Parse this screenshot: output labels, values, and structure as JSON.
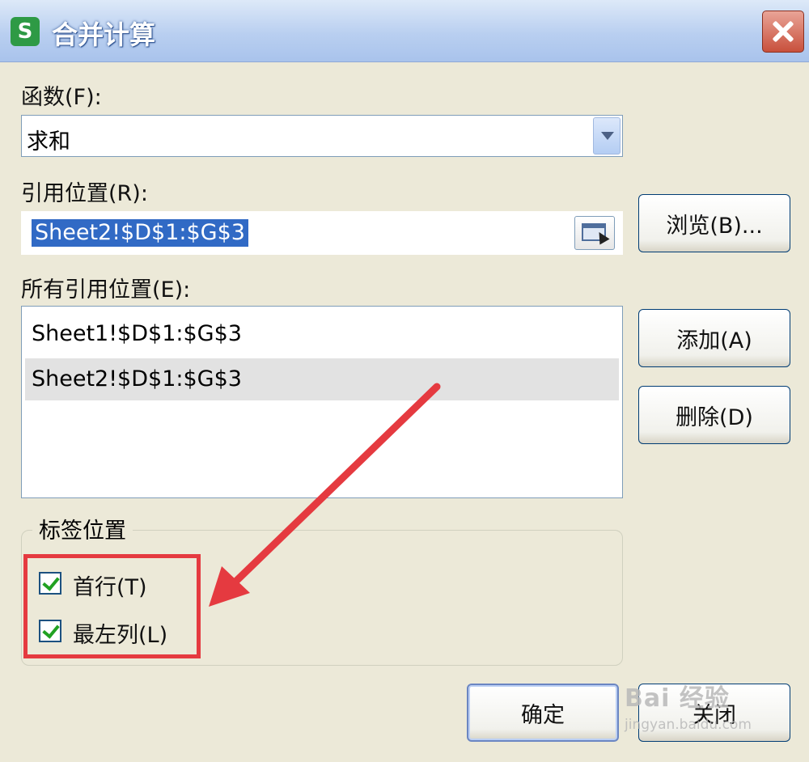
{
  "window": {
    "app_icon_letter": "S",
    "title": "合并计算"
  },
  "function_field": {
    "label": "函数(F):",
    "value": "求和"
  },
  "reference_field": {
    "label": "引用位置(R):",
    "value": "Sheet2!$D$1:$G$3"
  },
  "all_references": {
    "label": "所有引用位置(E):",
    "items": [
      "Sheet1!$D$1:$G$3",
      "Sheet2!$D$1:$G$3"
    ],
    "selected_index": 1
  },
  "label_position": {
    "title": "标签位置",
    "top_row": {
      "label": "首行(T)",
      "checked": true
    },
    "left_column": {
      "label": "最左列(L)",
      "checked": true
    }
  },
  "buttons": {
    "browse": "浏览(B)...",
    "add": "添加(A)",
    "delete": "删除(D)",
    "ok": "确定",
    "close": "关闭"
  },
  "watermark": {
    "main": "Bai 经验",
    "sub": "jingyan.baidu.com"
  },
  "colors": {
    "annotation": "#e53a40",
    "selection": "#316ac5",
    "checkmark": "#21a121"
  }
}
